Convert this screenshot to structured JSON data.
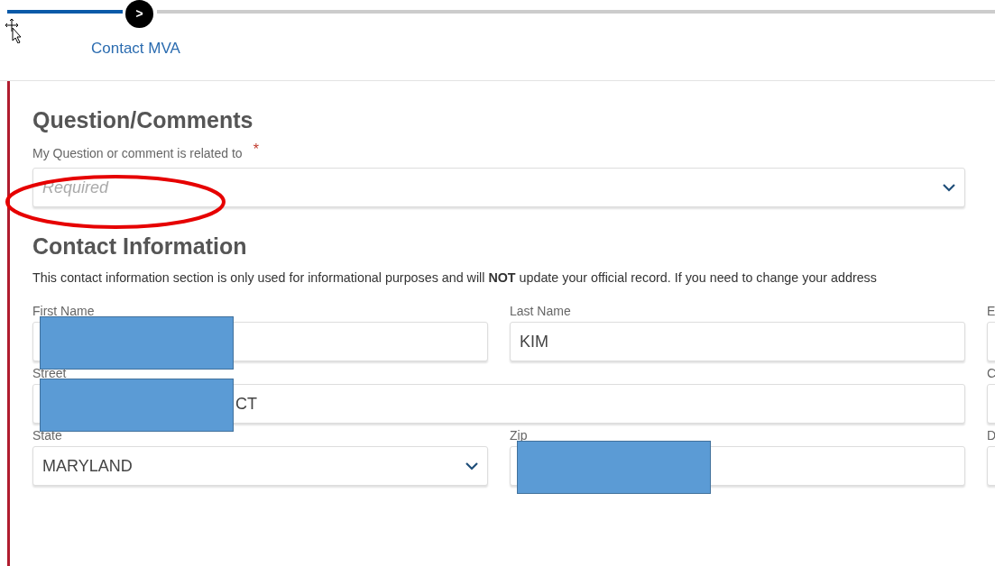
{
  "stepper": {
    "label": "Contact MVA",
    "button": ">"
  },
  "questions": {
    "heading": "Question/Comments",
    "label": "My Question or comment is related to",
    "required_mark": "*",
    "placeholder": "Required",
    "kind": "select",
    "annotated": true
  },
  "contact": {
    "heading": "Contact Information",
    "notice": "This contact information section is only used for informational purposes and will **NOT** update your official record. If you need to change your address",
    "fields": [
      {
        "label": "First Name",
        "kind": "text",
        "redacted": true
      },
      {
        "label": "Last Name",
        "kind": "text",
        "value": "KIM",
        "redacted": false
      },
      {
        "label": "E",
        "kind": "text",
        "redacted": false
      },
      {
        "label": "Street",
        "kind": "long-text",
        "value": "CT",
        "redacted": true
      },
      {
        "label": "C",
        "kind": "text",
        "redacted": false
      },
      {
        "label": "State",
        "kind": "select",
        "value": "MARYLAND",
        "redacted": false
      },
      {
        "label": "Zip",
        "kind": "text",
        "redacted": true
      },
      {
        "label": "D",
        "kind": "text",
        "redacted": false
      }
    ]
  }
}
